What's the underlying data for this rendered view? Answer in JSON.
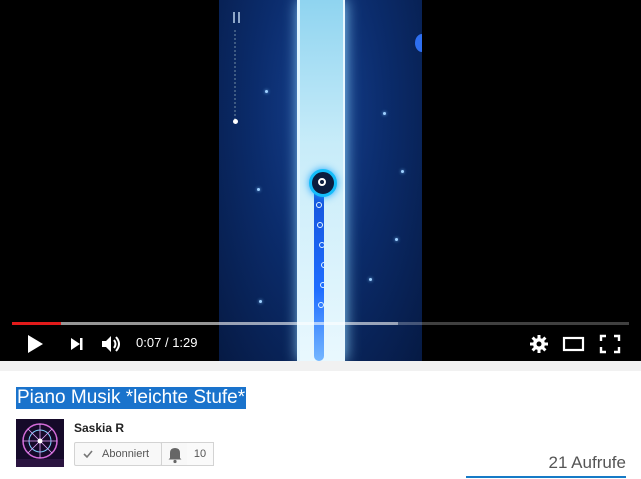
{
  "player": {
    "current_time": "0:07",
    "separator": "/",
    "duration": "1:29",
    "played_fraction": 0.079,
    "buffered_fraction": 0.625,
    "controls": {
      "play": "play-icon",
      "next": "next-icon",
      "volume": "volume-icon",
      "settings": "gear-icon",
      "theater": "theater-mode-icon",
      "fullscreen": "fullscreen-icon"
    },
    "colors": {
      "progress": "#e31b1b",
      "frame_bg": "#0b2c6c",
      "lane_glow": "#c8ecf9",
      "orb_ring": "#14bdfa"
    }
  },
  "video": {
    "title": "Piano Musik *leichte Stufe*",
    "title_highlight": "#1a73cc",
    "views": "21 Aufrufe"
  },
  "channel": {
    "name": "Saskia R",
    "subscribe_label": "Abonniert",
    "subscriber_count": "10",
    "accent": "#167ac6"
  }
}
